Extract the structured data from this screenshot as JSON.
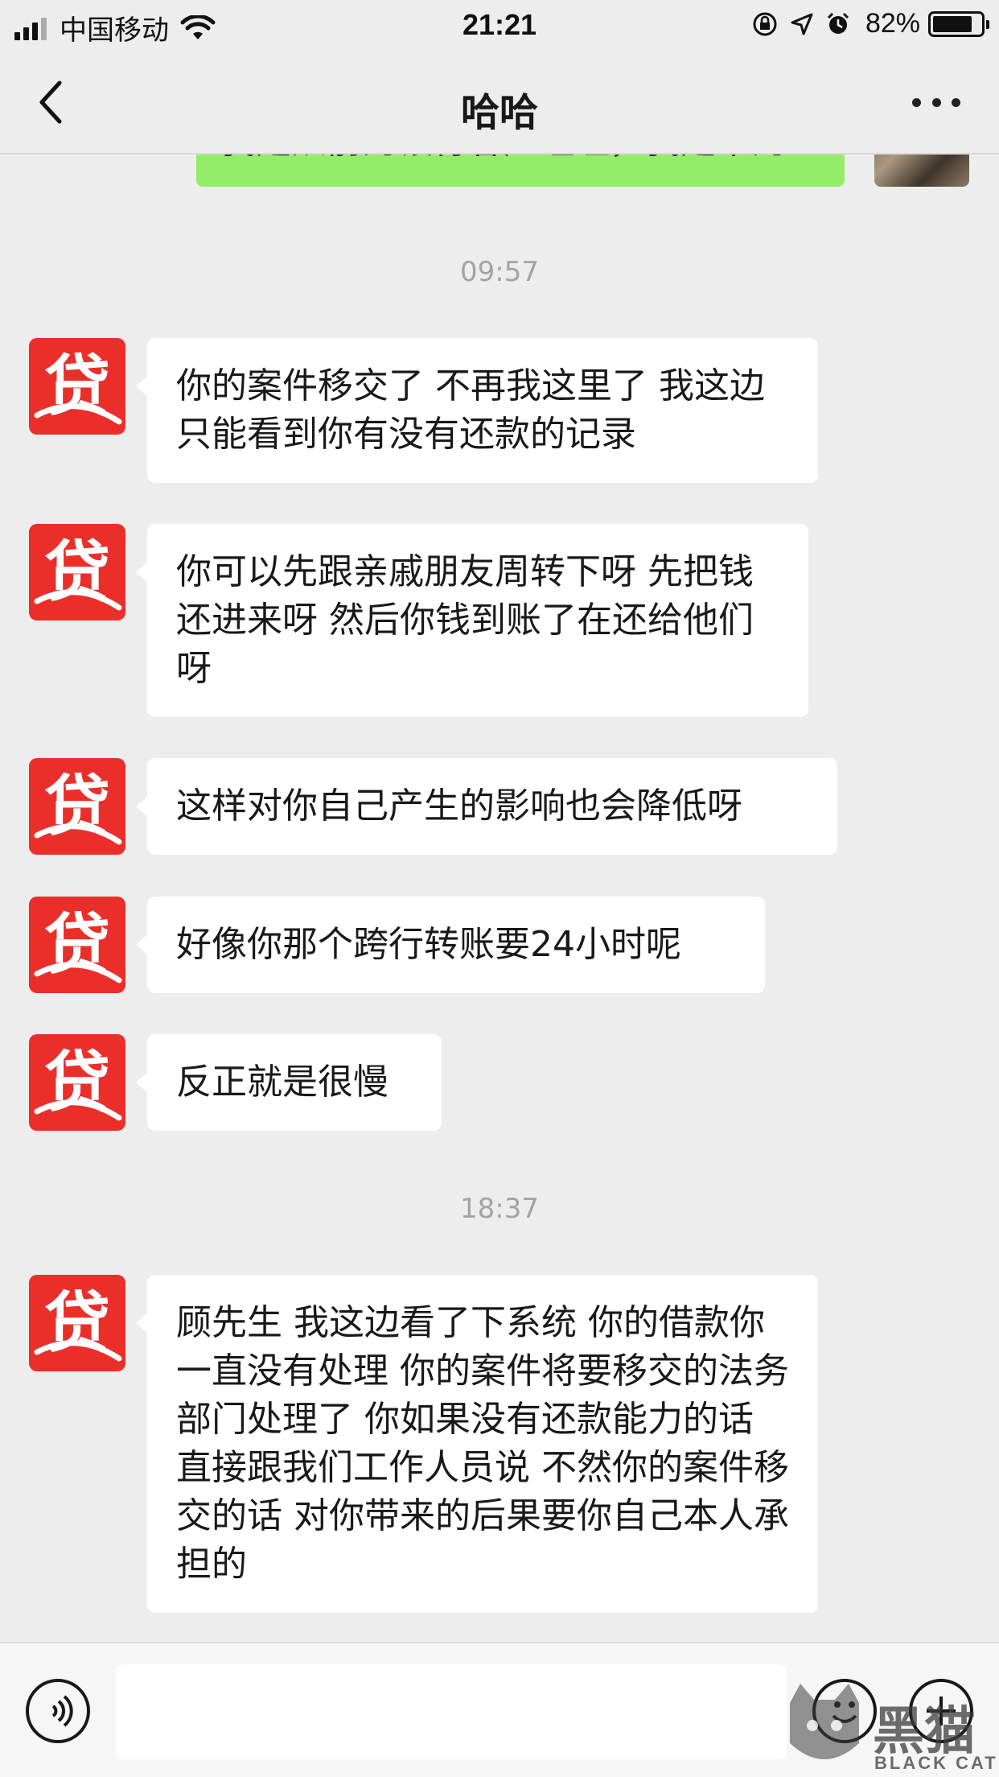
{
  "status_bar": {
    "carrier": "中国移动",
    "time": "21:21",
    "battery_percent": "82%",
    "battery_level": 0.82
  },
  "nav": {
    "title": "哈哈",
    "back_icon": "chevron-left-icon",
    "more_icon": "more-dots-icon"
  },
  "chat": {
    "partial_outgoing_text": "我是从前的银行客户经理，我是来的",
    "timestamps": [
      "09:57",
      "18:37"
    ],
    "messages": [
      {
        "sender": "贷",
        "text": "你的案件移交了 不再我这里了 我这边只能看到你有没有还款的记录"
      },
      {
        "sender": "贷",
        "text": "你可以先跟亲戚朋友周转下呀 先把钱还进来呀 然后你钱到账了在还给他们呀"
      },
      {
        "sender": "贷",
        "text": "这样对你自己产生的影响也会降低呀"
      },
      {
        "sender": "贷",
        "text": "好像你那个跨行转账要24小时呢"
      },
      {
        "sender": "贷",
        "text": "反正就是很慢"
      },
      {
        "sender": "贷",
        "text": "顾先生 我这边看了下系统 你的借款你一直没有处理  你的案件将要移交的法务部门处理了 你如果没有还款能力的话 直接跟我们工作人员说 不然你的案件移交的话 对你带来的后果要你自己本人承担的"
      }
    ]
  },
  "input_bar": {
    "input_value": "",
    "voice_icon": "voice-icon",
    "emoji_icon": "emoji-icon",
    "plus_icon": "plus-icon"
  },
  "watermark": {
    "text": "黑猫",
    "sub": "BLACK CAT"
  },
  "colors": {
    "background": "#ededed",
    "outgoing_bubble": "#95ec69",
    "incoming_bubble": "#ffffff",
    "avatar_red": "#ea2f2b"
  }
}
